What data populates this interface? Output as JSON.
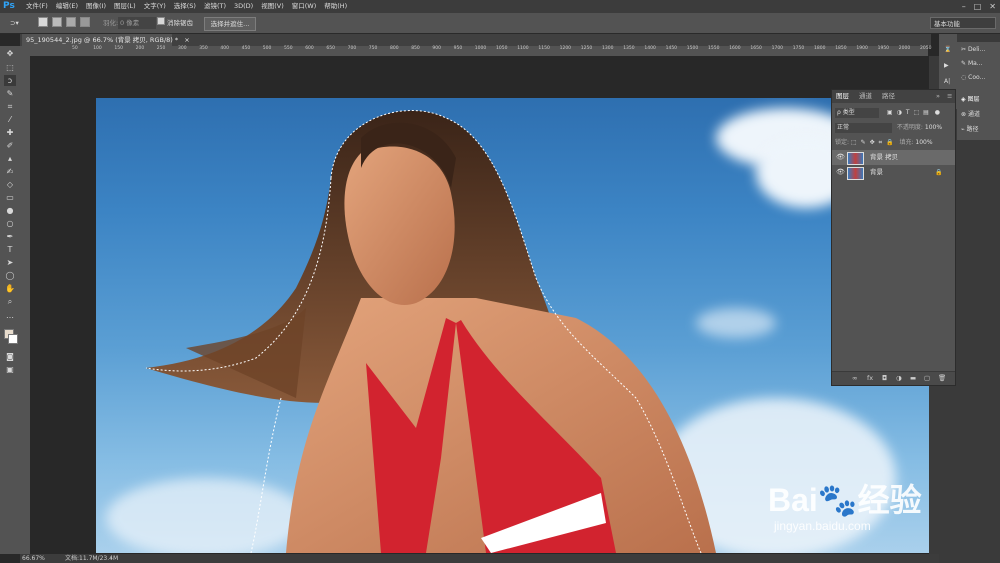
{
  "app": {
    "logo": "Ps"
  },
  "menu": [
    "文件(F)",
    "编辑(E)",
    "图像(I)",
    "图层(L)",
    "文字(Y)",
    "选择(S)",
    "滤镜(T)",
    "3D(D)",
    "视图(V)",
    "窗口(W)",
    "帮助(H)"
  ],
  "window_controls": {
    "minimize": "–",
    "maximize": "□",
    "close": "✕"
  },
  "options": {
    "feather_label": "羽化:",
    "feather_value": "0 像素",
    "antialias_label": "消除锯齿",
    "select_mask_button": "选择并遮住...",
    "workspace": "基本功能"
  },
  "document_tab": {
    "title": "95_190544_2.jpg @ 66.7% (背景 拷贝, RGB/8) *",
    "close": "×"
  },
  "ruler_ticks": [
    "50",
    "100",
    "150",
    "200",
    "250",
    "300",
    "350",
    "400",
    "450",
    "500",
    "550",
    "600",
    "650",
    "700",
    "750",
    "800",
    "850",
    "900",
    "950",
    "1000",
    "1050",
    "1100",
    "1150",
    "1200",
    "1250",
    "1300",
    "1350",
    "1400",
    "1450",
    "1500",
    "1550",
    "1600",
    "1650",
    "1700",
    "1750",
    "1800",
    "1850",
    "1900",
    "1950",
    "2000",
    "2050",
    "2100"
  ],
  "tools": [
    "move",
    "marquee",
    "lasso",
    "quick-select",
    "crop",
    "eyedropper",
    "healing",
    "brush",
    "stamp",
    "history-brush",
    "eraser",
    "gradient",
    "blur",
    "dodge",
    "pen",
    "type",
    "path-select",
    "shape",
    "hand",
    "zoom",
    "more",
    "colors",
    "quickmask",
    "screenmode"
  ],
  "right_dock": {
    "items_top": [
      "Deli...",
      "Ma...",
      "Coo..."
    ],
    "items_panels": [
      "图层",
      "通道",
      "路径"
    ]
  },
  "layers_panel": {
    "tabs": [
      "图层",
      "通道",
      "路径"
    ],
    "filter_label": "ρ 类型",
    "blend_mode": "正常",
    "opacity_label": "不透明度:",
    "opacity_value": "100%",
    "lock_label": "锁定:",
    "fill_label": "填充:",
    "fill_value": "100%",
    "layers": [
      {
        "name": "背景 拷贝",
        "selected": true,
        "locked": false
      },
      {
        "name": "背景",
        "selected": false,
        "locked": true
      }
    ],
    "bottom_icons": [
      "link-icon",
      "fx-icon",
      "mask-icon",
      "adjustment-icon",
      "folder-icon",
      "new-layer-icon",
      "trash-icon"
    ],
    "bottom_labels": [
      "∞",
      "fx",
      "◘",
      "◑",
      "▬",
      "▢",
      "🗑"
    ]
  },
  "status": {
    "zoom": "66.67%",
    "doc": "文档:11.7M/23.4M"
  },
  "watermark": {
    "brand": "Bai🐾经验",
    "url": "jingyan.baidu.com"
  }
}
